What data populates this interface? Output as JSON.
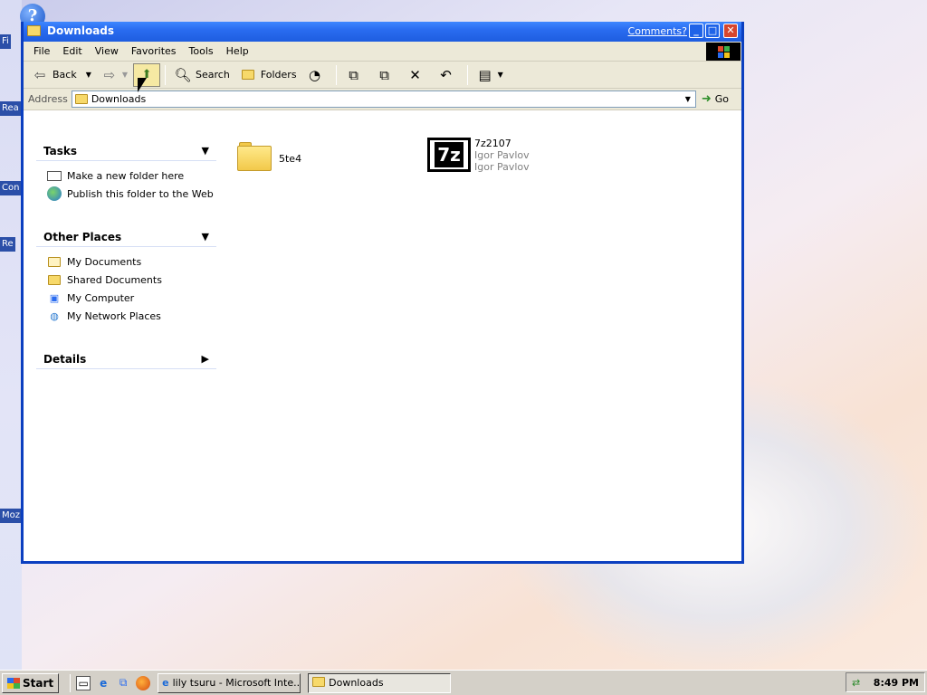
{
  "window": {
    "title": "Downloads",
    "comments_link": "Comments?",
    "buttons": {
      "minimize": "_",
      "maximize": "□",
      "close": "✕"
    }
  },
  "menu": [
    "File",
    "Edit",
    "View",
    "Favorites",
    "Tools",
    "Help"
  ],
  "toolbar": {
    "back_label": "Back",
    "search_label": "Search",
    "folders_label": "Folders"
  },
  "address": {
    "label": "Address",
    "value": "Downloads",
    "go_label": "Go"
  },
  "task_pane": {
    "tasks": {
      "title": "Tasks",
      "items": [
        "Make a new folder here",
        "Publish this folder to the Web"
      ]
    },
    "other_places": {
      "title": "Other Places",
      "items": [
        "My Documents",
        "Shared Documents",
        "My Computer",
        "My Network Places"
      ]
    },
    "details": {
      "title": "Details"
    }
  },
  "files": [
    {
      "name": "5te4",
      "type": "folder"
    },
    {
      "name": "7z2107",
      "line2": "Igor Pavlov",
      "line3": "Igor Pavlov",
      "type": "7z-installer",
      "icon_text": "7z"
    }
  ],
  "desktop_stubs": [
    "Fi",
    "Rea",
    "Con",
    "Re",
    "Moz"
  ],
  "taskbar": {
    "start_label": "Start",
    "tasks": [
      {
        "label": "lily tsuru - Microsoft Inte..."
      },
      {
        "label": "Downloads",
        "active": true
      }
    ],
    "clock": "8:49 PM"
  },
  "colors": {
    "title_bar": "#2a6cf0",
    "window_border": "#0b3fc0",
    "chrome": "#ece9d8",
    "taskbar": "#d4d0c8"
  }
}
